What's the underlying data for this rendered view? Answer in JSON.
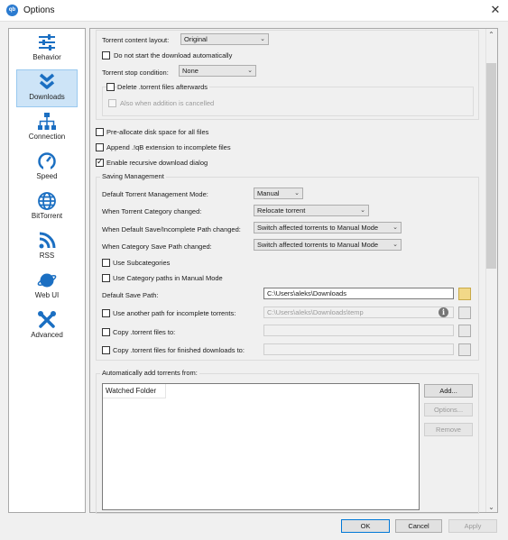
{
  "window": {
    "title": "Options",
    "app_icon_text": "qb",
    "close_glyph": "✕"
  },
  "sidebar": {
    "items": [
      {
        "label": "Behavior",
        "icon": "sliders-icon"
      },
      {
        "label": "Downloads",
        "icon": "double-chevron-down-icon",
        "active": true
      },
      {
        "label": "Connection",
        "icon": "network-icon"
      },
      {
        "label": "Speed",
        "icon": "speedometer-icon"
      },
      {
        "label": "BitTorrent",
        "icon": "globe-icon"
      },
      {
        "label": "RSS",
        "icon": "rss-icon"
      },
      {
        "label": "Web UI",
        "icon": "planet-icon"
      },
      {
        "label": "Advanced",
        "icon": "tools-icon"
      }
    ]
  },
  "torrent_options": {
    "content_layout_label": "Torrent content layout:",
    "content_layout_value": "Original",
    "dont_start_label": "Do not start the download automatically",
    "stop_condition_label": "Torrent stop condition:",
    "stop_condition_value": "None",
    "delete_torrent_label": "Delete .torrent files afterwards",
    "also_when_cancelled_label": "Also when addition is cancelled"
  },
  "general_checks": {
    "preallocate_label": "Pre-allocate disk space for all files",
    "append_ext_label": "Append .!qB extension to incomplete files",
    "recursive_dialog_label": "Enable recursive download dialog"
  },
  "saving": {
    "group_title": "Saving Management",
    "mode_label": "Default Torrent Management Mode:",
    "mode_value": "Manual",
    "category_changed_label": "When Torrent Category changed:",
    "category_changed_value": "Relocate torrent",
    "default_path_changed_label": "When Default Save/Incomplete Path changed:",
    "default_path_changed_value": "Switch affected torrents to Manual Mode",
    "category_path_changed_label": "When Category Save Path changed:",
    "category_path_changed_value": "Switch affected torrents to Manual Mode",
    "use_subcategories_label": "Use Subcategories",
    "use_category_paths_label": "Use Category paths in Manual Mode",
    "default_save_path_label": "Default Save Path:",
    "default_save_path_value": "C:\\Users\\aleks\\Downloads",
    "incomplete_path_label": "Use another path for incomplete torrents:",
    "incomplete_path_value": "C:\\Users\\aleks\\Downloads\\temp",
    "copy_torrent_label": "Copy .torrent files to:",
    "copy_finished_label": "Copy .torrent files for finished downloads to:",
    "info_glyph": "i"
  },
  "auto_add": {
    "group_title": "Automatically add torrents from:",
    "column_header": "Watched Folder",
    "add_button": "Add...",
    "options_button": "Options...",
    "remove_button": "Remove"
  },
  "footer": {
    "ok": "OK",
    "cancel": "Cancel",
    "apply": "Apply"
  }
}
